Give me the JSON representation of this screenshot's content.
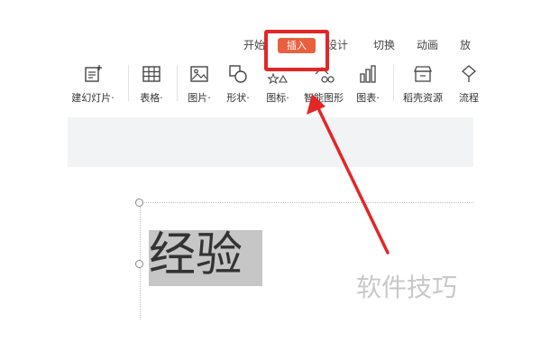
{
  "tabs": [
    {
      "label": "开始"
    },
    {
      "label": "插入"
    },
    {
      "label": "设计"
    },
    {
      "label": "切换"
    },
    {
      "label": "动画"
    },
    {
      "label": "放"
    }
  ],
  "ribbon": {
    "new_slide_label": "建幻灯片·",
    "table_label": "表格·",
    "picture_label": "图片·",
    "shape_label": "形状·",
    "icon_label": "图标·",
    "smartart_label": "智能图形",
    "chart_label": "图表·",
    "resource_label": "稻壳资源",
    "flowchart_label": "流程"
  },
  "slide": {
    "selected_text": "经验"
  },
  "watermark": "软件技巧",
  "colors": {
    "accent": "#e8603c",
    "annotation_red": "#e32626"
  }
}
